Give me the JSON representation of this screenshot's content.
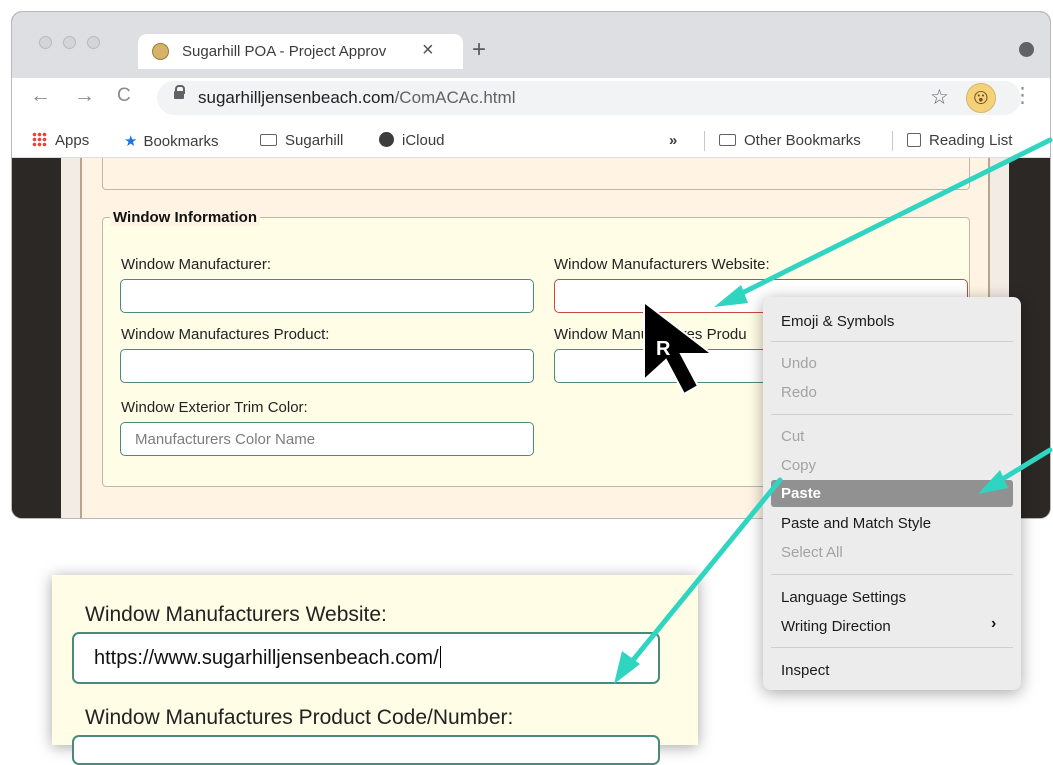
{
  "browser": {
    "tab_title": "Sugarhill POA - Project Approv",
    "tab_close": "×",
    "new_tab": "+",
    "url_domain": "sugarhilljensenbeach.com",
    "url_path": "/ComACAc.html",
    "nav": {
      "back": "←",
      "forward": "→",
      "reload": "C"
    },
    "star": "☆",
    "avatar": "😮",
    "menu": "⋮"
  },
  "bookmarks": {
    "items": [
      "Apps",
      "Bookmarks",
      "Sugarhill",
      "iCloud"
    ],
    "overflow": "»",
    "other": "Other Bookmarks",
    "reading_list": "Reading List"
  },
  "form": {
    "legend": "Window Information",
    "fields": [
      {
        "label": "Window Manufacturer:",
        "value": ""
      },
      {
        "label": "Window Manufacturers Website:",
        "value": ""
      },
      {
        "label": "Window Manufactures Product:",
        "value": ""
      },
      {
        "label": "Window Manufactures Produ",
        "value": ""
      },
      {
        "label": "Window Exterior Trim Color:",
        "placeholder": "Manufacturers Color Name"
      }
    ]
  },
  "cursor_badge": "R",
  "context_menu": {
    "items": [
      {
        "label": "Emoji & Symbols",
        "enabled": true
      },
      {
        "label": "Undo",
        "enabled": false
      },
      {
        "label": "Redo",
        "enabled": false
      },
      {
        "label": "Cut",
        "enabled": false
      },
      {
        "label": "Copy",
        "enabled": false
      },
      {
        "label": "Paste",
        "enabled": true,
        "highlighted": true
      },
      {
        "label": "Paste and Match Style",
        "enabled": true
      },
      {
        "label": "Select All",
        "enabled": false
      },
      {
        "label": "Language Settings",
        "enabled": true
      },
      {
        "label": "Writing Direction",
        "enabled": true
      },
      {
        "label": "Inspect",
        "enabled": true
      }
    ],
    "submenu_chevron": "›"
  },
  "zoom": {
    "label": "Window Manufacturers Website:",
    "value": "https://www.sugarhilljensenbeach.com/",
    "next_label": "Window Manufactures Product Code/Number:"
  },
  "colors": {
    "arrow": "#2fd5c0",
    "input_border": "#4a8a7c",
    "error_border": "#c84a3e"
  }
}
